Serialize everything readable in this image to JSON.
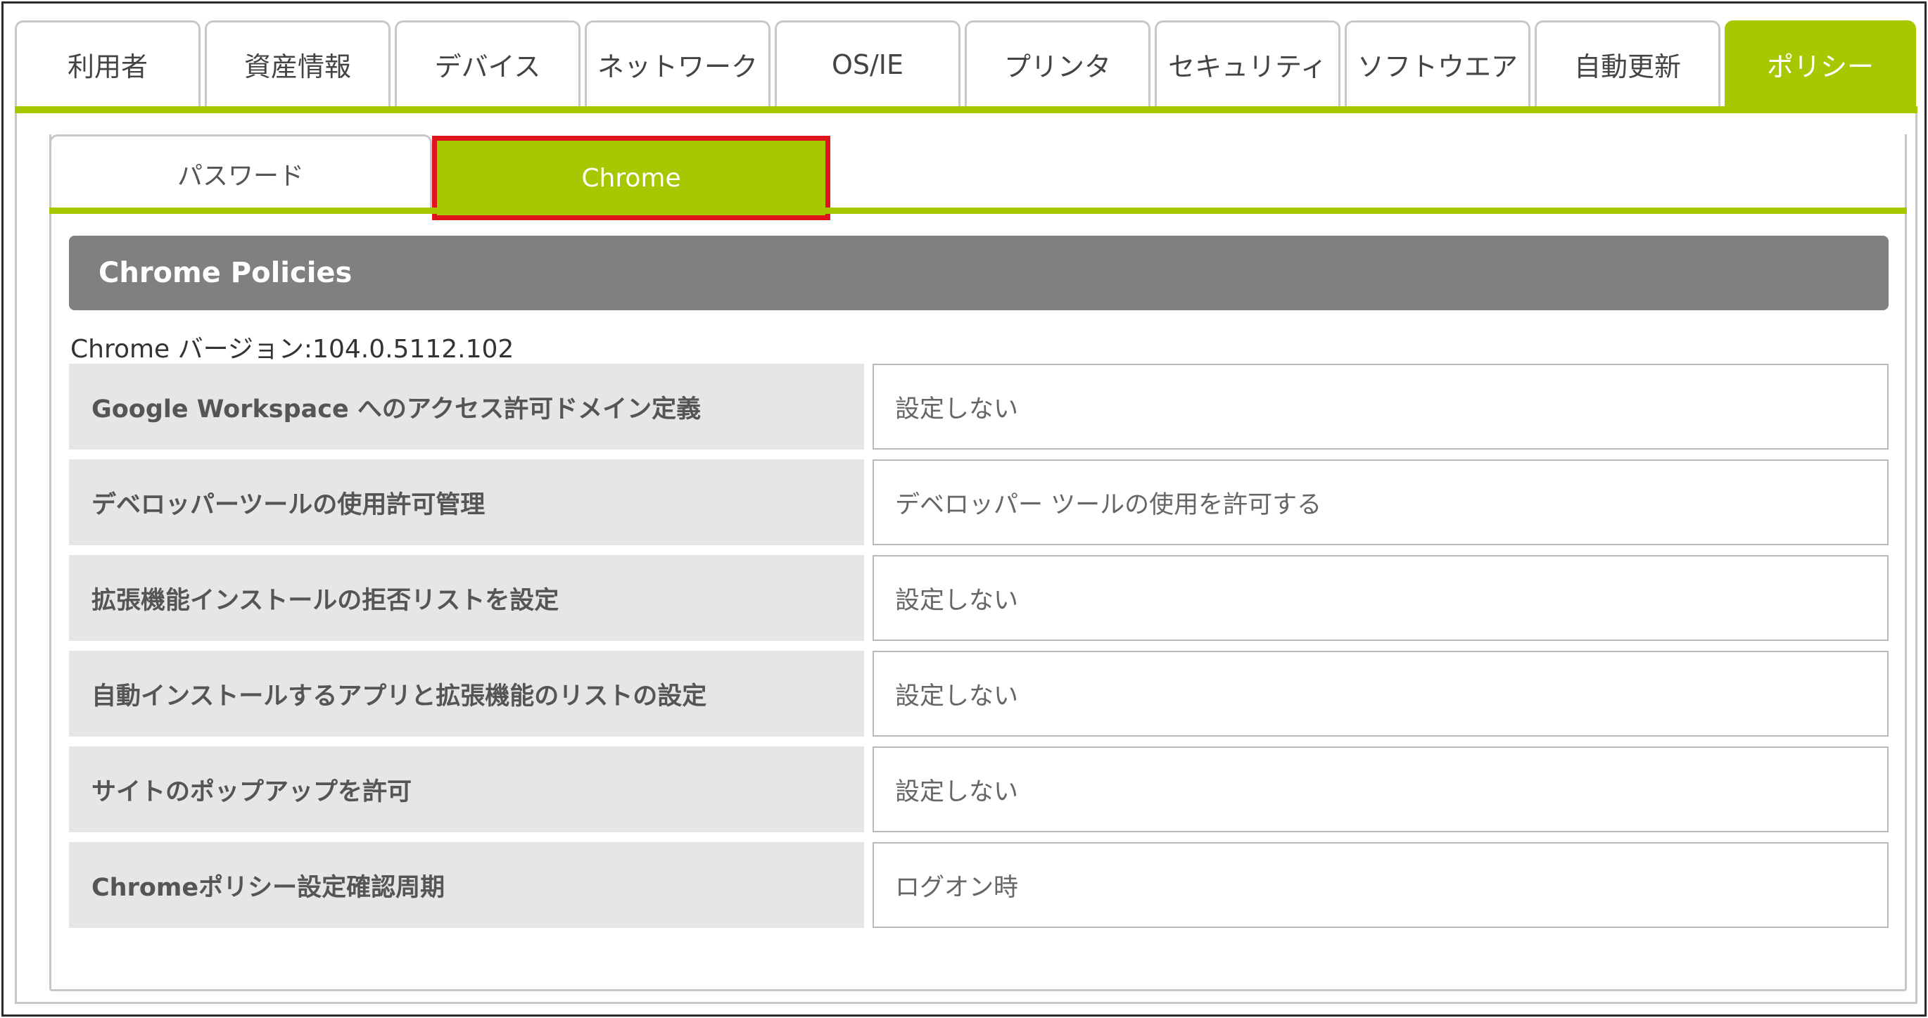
{
  "top_tabs": [
    {
      "label": "利用者"
    },
    {
      "label": "資産情報"
    },
    {
      "label": "デバイス"
    },
    {
      "label": "ネットワーク"
    },
    {
      "label": "OS/IE"
    },
    {
      "label": "プリンタ"
    },
    {
      "label": "セキュリティ"
    },
    {
      "label": "ソフトウエア"
    },
    {
      "label": "自動更新"
    },
    {
      "label": "ポリシー",
      "active": true
    }
  ],
  "sub_tabs": [
    {
      "label": "パスワード"
    },
    {
      "label": "Chrome",
      "active": true
    }
  ],
  "section": {
    "title": "Chrome Policies",
    "version_line": "Chrome バージョン:104.0.5112.102"
  },
  "policies": [
    {
      "label": "Google Workspace へのアクセス許可ドメイン定義",
      "value": "設定しない"
    },
    {
      "label": "デベロッパーツールの使用許可管理",
      "value": "デベロッパー ツールの使用を許可する"
    },
    {
      "label": "拡張機能インストールの拒否リストを設定",
      "value": "設定しない"
    },
    {
      "label": "自動インストールするアプリと拡張機能のリストの設定",
      "value": "設定しない"
    },
    {
      "label": "サイトのポップアップを許可",
      "value": "設定しない"
    },
    {
      "label": "Chromeポリシー設定確認周期",
      "value": "ログオン時"
    }
  ],
  "colors": {
    "accent": "#a6c800",
    "highlight_border": "#e0151b",
    "section_header_bg": "#808080",
    "label_cell_bg": "#e6e6e6"
  }
}
